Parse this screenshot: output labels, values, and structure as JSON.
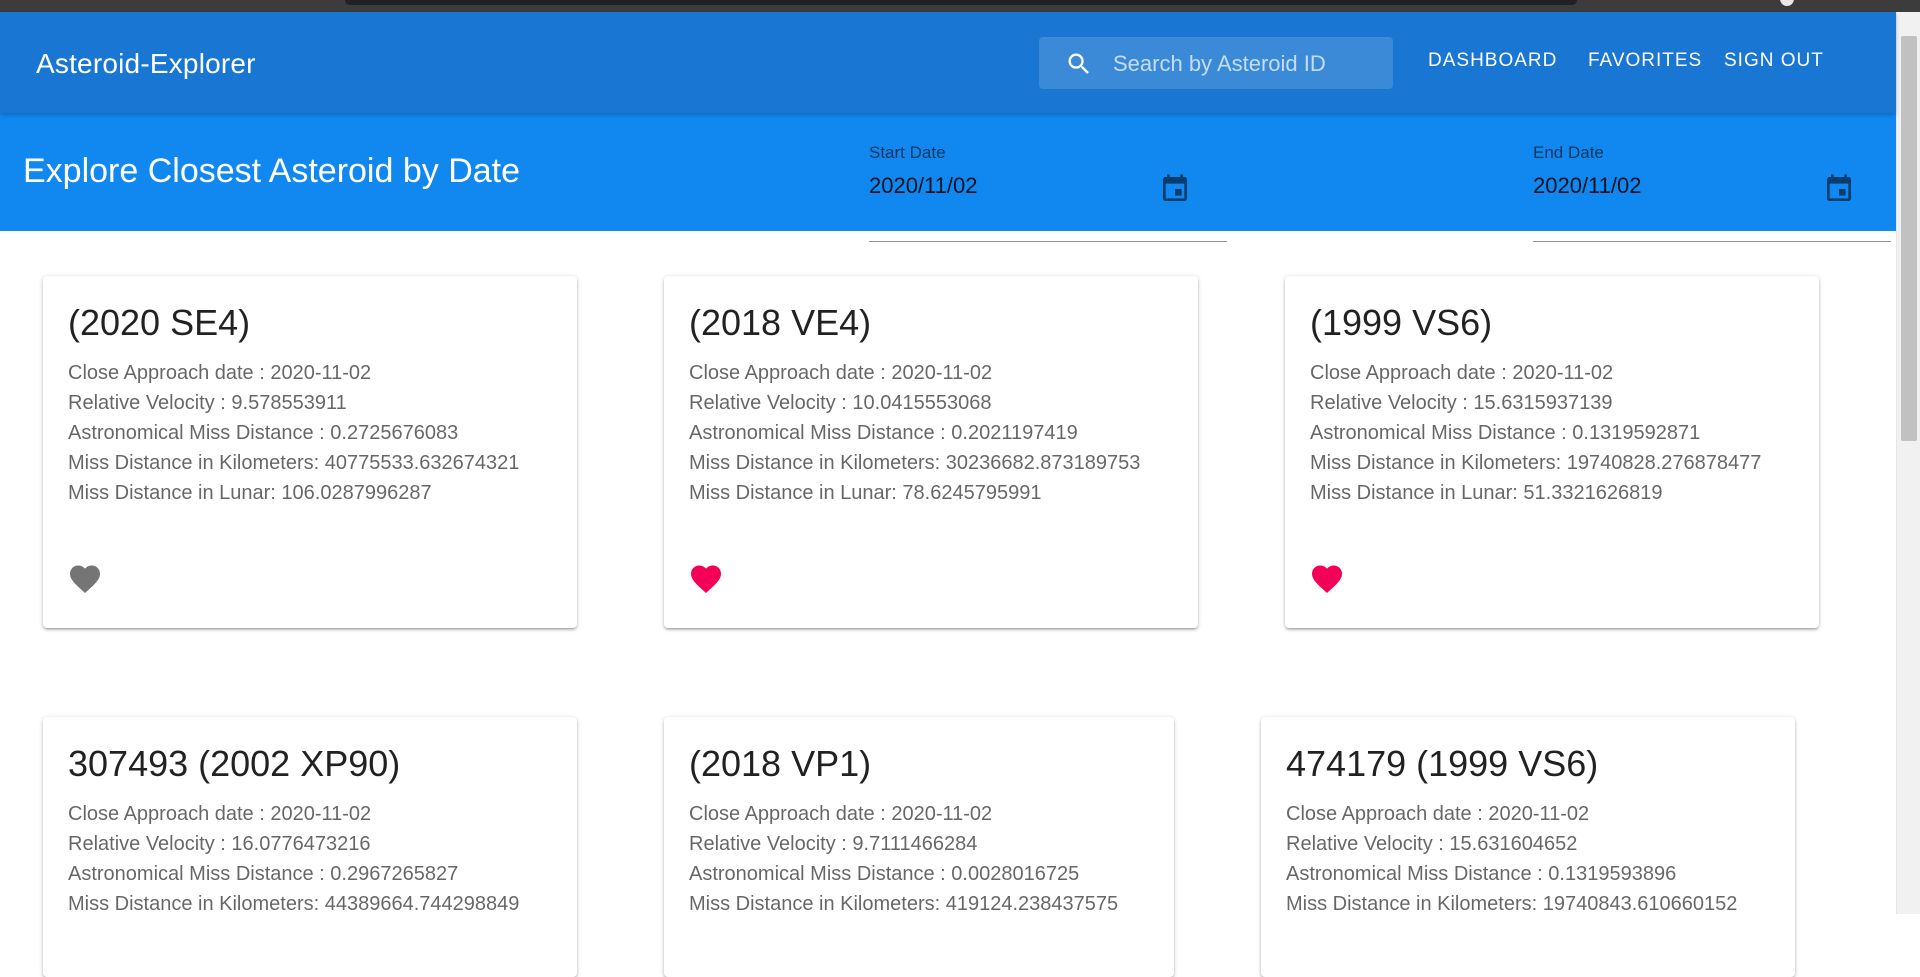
{
  "app": {
    "title": "Asteroid-Explorer"
  },
  "search": {
    "placeholder": "Search by Asteroid ID"
  },
  "nav": {
    "dashboard": "DASHBOARD",
    "favorites": "FAVORITES",
    "sign_out": "SIGN OUT"
  },
  "toolbar": {
    "heading": "Explore Closest Asteroid by Date",
    "start_date": {
      "label": "Start Date",
      "value": "2020/11/02"
    },
    "end_date": {
      "label": "End Date",
      "value": "2020/11/02"
    }
  },
  "cards": [
    {
      "name": "(2020 SE4)",
      "close_approach": "Close Approach date : 2020-11-02",
      "velocity": "Relative Velocity : 9.578553911",
      "astro_distance": "Astronomical Miss Distance : 0.2725676083",
      "km_distance": "Miss Distance in Kilometers: 40775533.632674321",
      "lunar_distance": "Miss Distance in Lunar: 106.0287996287",
      "favorite": false
    },
    {
      "name": "(2018 VE4)",
      "close_approach": "Close Approach date : 2020-11-02",
      "velocity": "Relative Velocity : 10.0415553068",
      "astro_distance": "Astronomical Miss Distance : 0.2021197419",
      "km_distance": "Miss Distance in Kilometers: 30236682.873189753",
      "lunar_distance": "Miss Distance in Lunar: 78.6245795991",
      "favorite": true
    },
    {
      "name": "(1999 VS6)",
      "close_approach": "Close Approach date : 2020-11-02",
      "velocity": "Relative Velocity : 15.6315937139",
      "astro_distance": "Astronomical Miss Distance : 0.1319592871",
      "km_distance": "Miss Distance in Kilometers: 19740828.276878477",
      "lunar_distance": "Miss Distance in Lunar: 51.3321626819",
      "favorite": true
    },
    {
      "name": "307493 (2002 XP90)",
      "close_approach": "Close Approach date : 2020-11-02",
      "velocity": "Relative Velocity : 16.0776473216",
      "astro_distance": "Astronomical Miss Distance : 0.2967265827",
      "km_distance": "Miss Distance in Kilometers: 44389664.744298849"
    },
    {
      "name": "(2018 VP1)",
      "close_approach": "Close Approach date : 2020-11-02",
      "velocity": "Relative Velocity : 9.7111466284",
      "astro_distance": "Astronomical Miss Distance : 0.0028016725",
      "km_distance": "Miss Distance in Kilometers: 419124.238437575"
    },
    {
      "name": "474179 (1999 VS6)",
      "close_approach": "Close Approach date : 2020-11-02",
      "velocity": "Relative Velocity : 15.631604652",
      "astro_distance": "Astronomical Miss Distance : 0.1319593896",
      "km_distance": "Miss Distance in Kilometers: 19740843.610660152"
    }
  ],
  "colors": {
    "appbar": "#1976d2",
    "toolbar": "#1188f0",
    "favorite_on": "#f50057",
    "favorite_off": "#757575"
  },
  "icons": {
    "search": "search-icon",
    "calendar": "calendar-icon",
    "favorite": "heart-icon"
  }
}
